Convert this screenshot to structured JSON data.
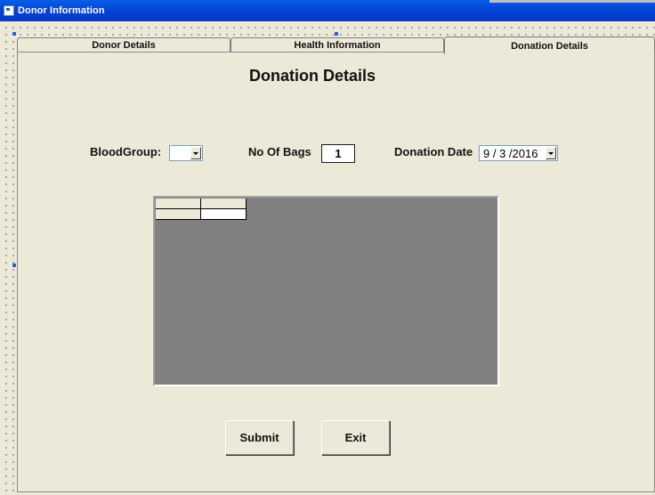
{
  "window": {
    "title": "Donor Information",
    "icon": "form-icon"
  },
  "tabs": [
    {
      "label": "Donor Details",
      "active": false
    },
    {
      "label": "Health Information",
      "active": false
    },
    {
      "label": "Donation Details",
      "active": true
    }
  ],
  "page": {
    "heading": "Donation Details"
  },
  "form": {
    "blood_group_label": "BloodGroup:",
    "blood_group_value": "",
    "bags_label": "No Of Bags",
    "bags_value": "1",
    "date_label": "Donation Date",
    "date_value": "9 / 3 /2016"
  },
  "buttons": {
    "submit": "Submit",
    "exit": "Exit"
  },
  "colors": {
    "titlebar": "#0348d6",
    "surface": "#ece9d8",
    "grid_bg": "#808080"
  }
}
